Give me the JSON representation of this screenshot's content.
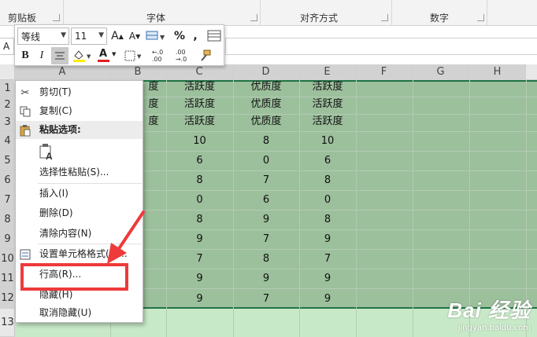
{
  "ribbon": {
    "groups": [
      "剪贴板",
      "字体",
      "对齐方式",
      "数字"
    ]
  },
  "namebox_text": "A",
  "minitoolbar": {
    "font_name": "等线",
    "font_size": "11",
    "grow_font": "A",
    "shrink_font": "A",
    "percent": "%",
    "comma": ",",
    "bold": "B",
    "italic": "I",
    "font_color_glyph": "A",
    "dec_increase": "←.0\n.00",
    "dec_decrease": ".00\n→.0"
  },
  "columns": [
    "A",
    "B",
    "C",
    "D",
    "E",
    "F",
    "G",
    "H"
  ],
  "rows": [
    "1",
    "2",
    "3",
    "4",
    "5",
    "6",
    "7",
    "8",
    "9",
    "10",
    "11",
    "12",
    "13"
  ],
  "cells": {
    "B": [
      "度",
      "度",
      "度",
      "",
      "",
      "",
      "",
      "",
      "",
      "",
      "",
      ""
    ],
    "C": [
      "活跃度",
      "活跃度",
      "活跃度",
      "10",
      "6",
      "8",
      "0",
      "8",
      "9",
      "7",
      "9",
      "9"
    ],
    "D": [
      "优质度",
      "优质度",
      "优质度",
      "8",
      "0",
      "7",
      "6",
      "9",
      "7",
      "8",
      "9",
      "7"
    ],
    "E": [
      "活跃度",
      "活跃度",
      "活跃度",
      "10",
      "6",
      "8",
      "0",
      "8",
      "9",
      "7",
      "9",
      "9"
    ]
  },
  "context_menu": {
    "cut": "剪切(T)",
    "copy": "复制(C)",
    "paste_header": "粘贴选项:",
    "paste_special": "选择性粘贴(S)...",
    "insert": "插入(I)",
    "delete": "删除(D)",
    "clear": "清除内容(N)",
    "format_cells": "设置单元格格式(F)...",
    "row_height": "行高(R)...",
    "hide": "隐藏(H)",
    "unhide": "取消隐藏(U)"
  },
  "watermark": {
    "logo": "Bai 经验",
    "url": "jingyan.baidu.com"
  },
  "colors": {
    "selection_fill": "#9cbf9c",
    "selection_border": "#217346",
    "annotation_red": "#ee3a3a"
  }
}
